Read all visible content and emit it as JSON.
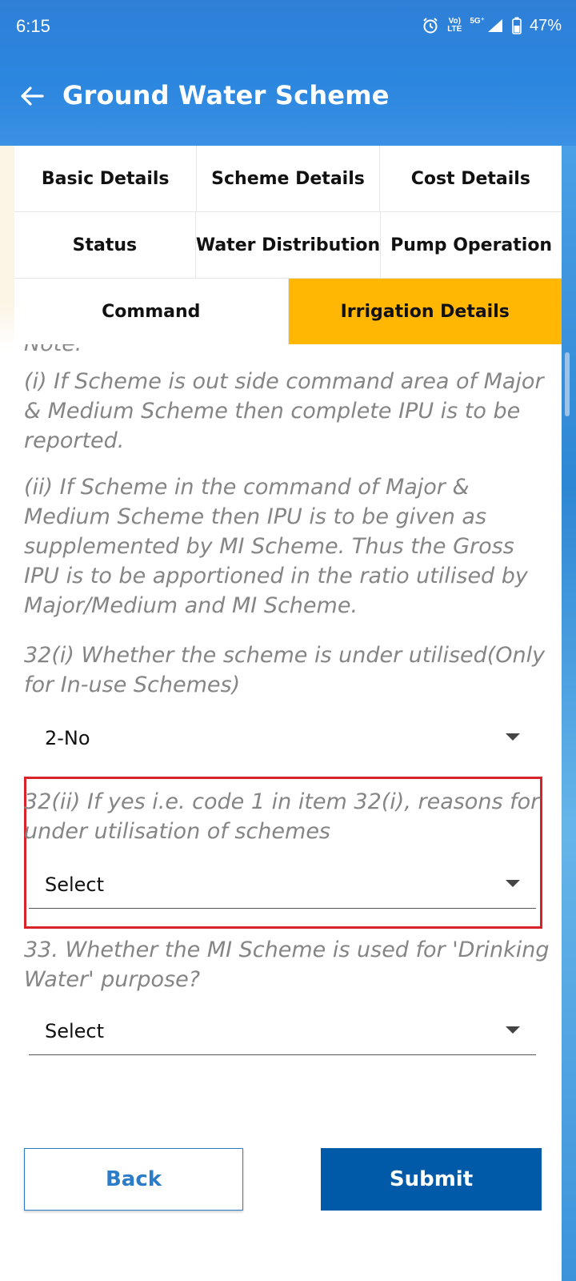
{
  "status_bar": {
    "time": "6:15",
    "battery": "47%",
    "network_top": "Vo)",
    "network_bottom": "LTE",
    "signal_label": "5G⁺",
    "icons": [
      "alarm-icon",
      "volte-icon",
      "signal-icon",
      "battery-icon"
    ]
  },
  "app_bar": {
    "title": "Ground Water Scheme",
    "back_icon": "arrow-left-icon"
  },
  "tabs": {
    "row1": [
      "Basic Details",
      "Scheme Details",
      "Cost Details"
    ],
    "row2": [
      "Status",
      "Water Distribution",
      "Pump Operation"
    ],
    "row3": [
      "Command",
      "Irrigation Details"
    ],
    "active": "Irrigation Details"
  },
  "content": {
    "note_heading": "Note:",
    "note_i": "(i) If Scheme is out side command area of Major & Medium Scheme then complete IPU is to be reported.",
    "note_ii": "(ii) If Scheme in the command of Major & Medium Scheme then IPU is to be given as supplemented by MI Scheme. Thus the Gross IPU is to be apportioned in the ratio utilised by Major/Medium and MI Scheme.",
    "q32i_label": "32(i) Whether the scheme is under utilised(Only for In-use Schemes)",
    "q32i_value": "2-No",
    "q32ii_label": "32(ii) If yes i.e. code 1 in item 32(i), reasons for under utilisation of schemes",
    "q32ii_value": "Select",
    "q33_label": "33. Whether the MI Scheme is used for 'Drinking Water' purpose?",
    "q33_value": "Select"
  },
  "buttons": {
    "back": "Back",
    "submit": "Submit"
  },
  "colors": {
    "header_blue": "#2b86df",
    "active_tab": "#ffb703",
    "submit_blue": "#005aa8",
    "highlight_red": "#d8232a",
    "hint_gray": "#858585"
  }
}
